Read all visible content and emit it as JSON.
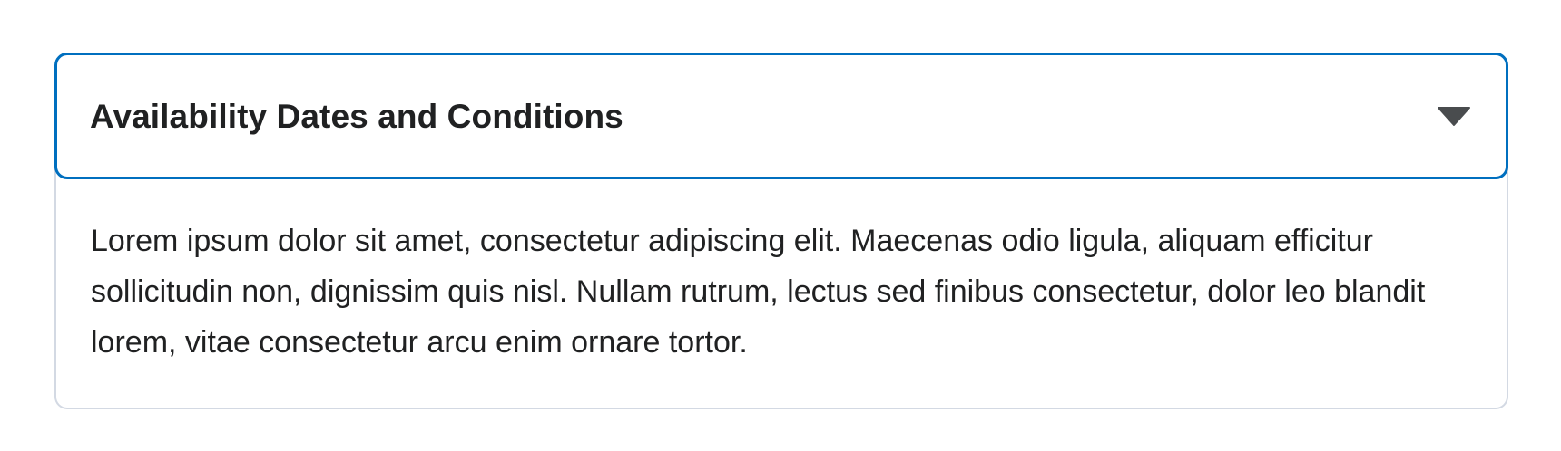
{
  "collapsible": {
    "title": "Availability Dates and Conditions",
    "expanded": true,
    "toggle_icon": "chevron-down-icon",
    "body": "Lorem ipsum dolor sit amet, consectetur adipiscing elit. Maecenas odio ligula, aliquam efficitur sollicitudin non, dignissim quis nisl. Nullam rutrum, lectus sed finibus consectetur, dolor leo blandit lorem, vitae consectetur arcu enim ornare tortor."
  },
  "colors": {
    "focus_border": "#006fbf",
    "panel_border": "#d3d9e3",
    "text": "#202122",
    "icon": "#494c4e"
  }
}
